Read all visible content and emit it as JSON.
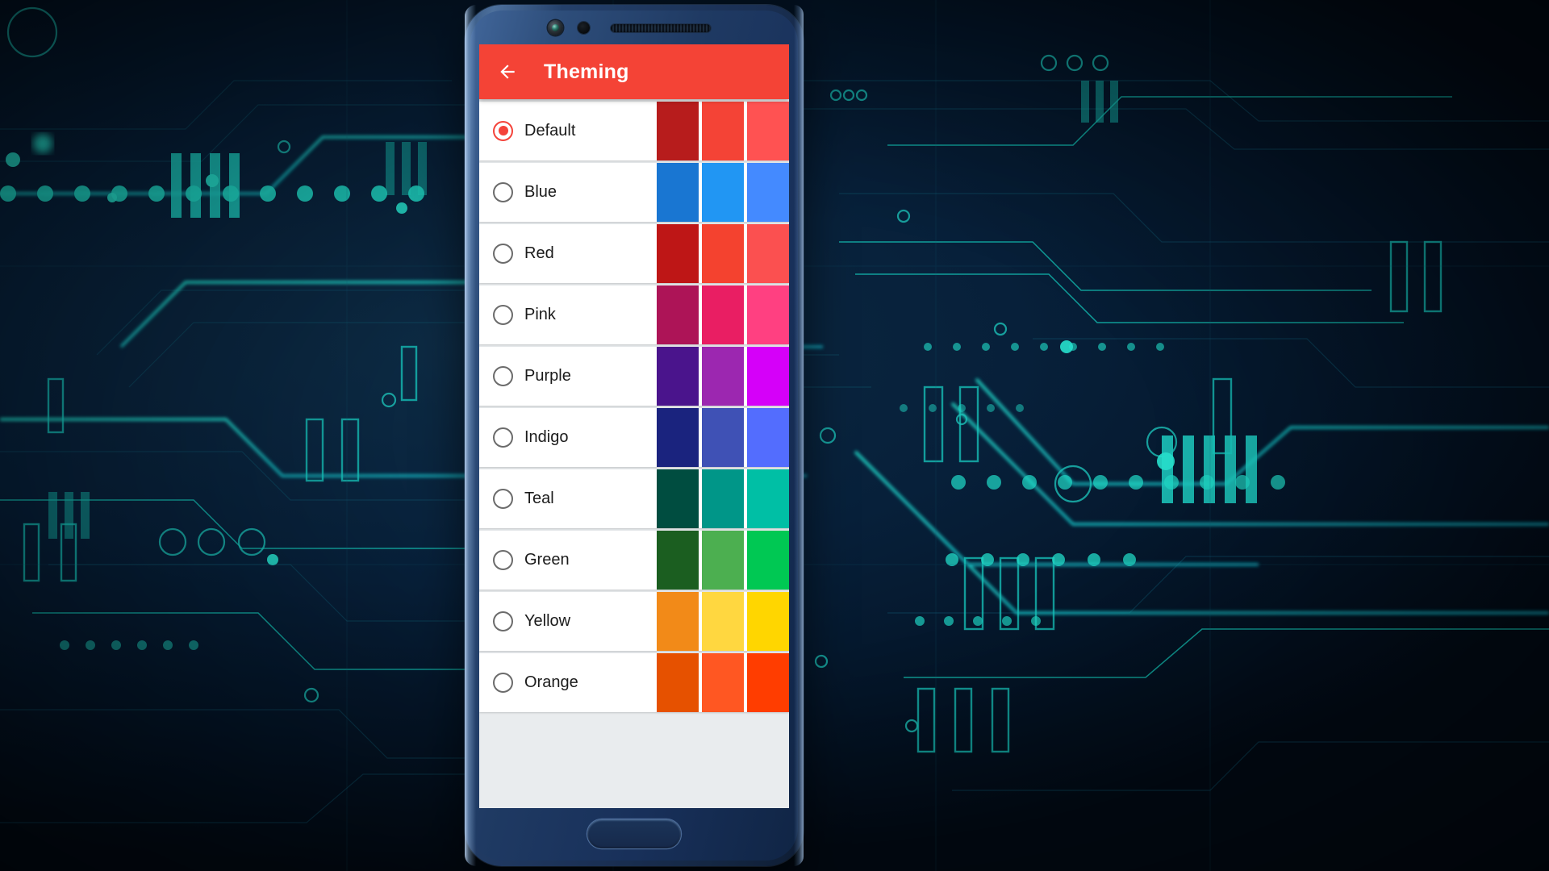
{
  "background": {
    "description": "dark navy circuit board pattern",
    "base_color": "#07203a",
    "trace_color": "#1fd9c8",
    "trace_dim_color": "#12697a"
  },
  "device": {
    "name": "android-phone-mockup",
    "frame_color": "#1f3a63",
    "bezel_color": "#2e4e7b",
    "hardware": {
      "camera": "camera-icon",
      "sensor": "proximity-sensor-icon",
      "speaker": "earpiece-speaker-icon",
      "home_button": "home-button"
    }
  },
  "appbar": {
    "title": "Theming",
    "color": "#F44336",
    "title_color": "#FFFFFF",
    "back_icon": "arrow-back-icon"
  },
  "list": {
    "selected": "Default",
    "items": [
      {
        "label": "Default",
        "selected": true,
        "swatches": [
          "#B71C1C",
          "#F44336",
          "#FF5252"
        ]
      },
      {
        "label": "Blue",
        "selected": false,
        "swatches": [
          "#1976D2",
          "#2196F3",
          "#448AFF"
        ]
      },
      {
        "label": "Red",
        "selected": false,
        "swatches": [
          "#BE1616",
          "#F4422F",
          "#FB5050"
        ]
      },
      {
        "label": "Pink",
        "selected": false,
        "swatches": [
          "#AD1457",
          "#E91E63",
          "#FF4081"
        ]
      },
      {
        "label": "Purple",
        "selected": false,
        "swatches": [
          "#4A148C",
          "#9C27B0",
          "#D500F9"
        ]
      },
      {
        "label": "Indigo",
        "selected": false,
        "swatches": [
          "#1A237E",
          "#3F51B5",
          "#536DFE"
        ]
      },
      {
        "label": "Teal",
        "selected": false,
        "swatches": [
          "#004D40",
          "#009688",
          "#00BFA5"
        ]
      },
      {
        "label": "Green",
        "selected": false,
        "swatches": [
          "#1B5E20",
          "#4CAF50",
          "#00C853"
        ]
      },
      {
        "label": "Yellow",
        "selected": false,
        "swatches": [
          "#F28A18",
          "#FFD740",
          "#FFD600"
        ]
      },
      {
        "label": "Orange",
        "selected": false,
        "swatches": [
          "#E65100",
          "#FF5722",
          "#FF3D00"
        ]
      }
    ]
  },
  "radio": {
    "checked_color": "#F4433A",
    "unchecked_color": "#6B6B6B"
  }
}
